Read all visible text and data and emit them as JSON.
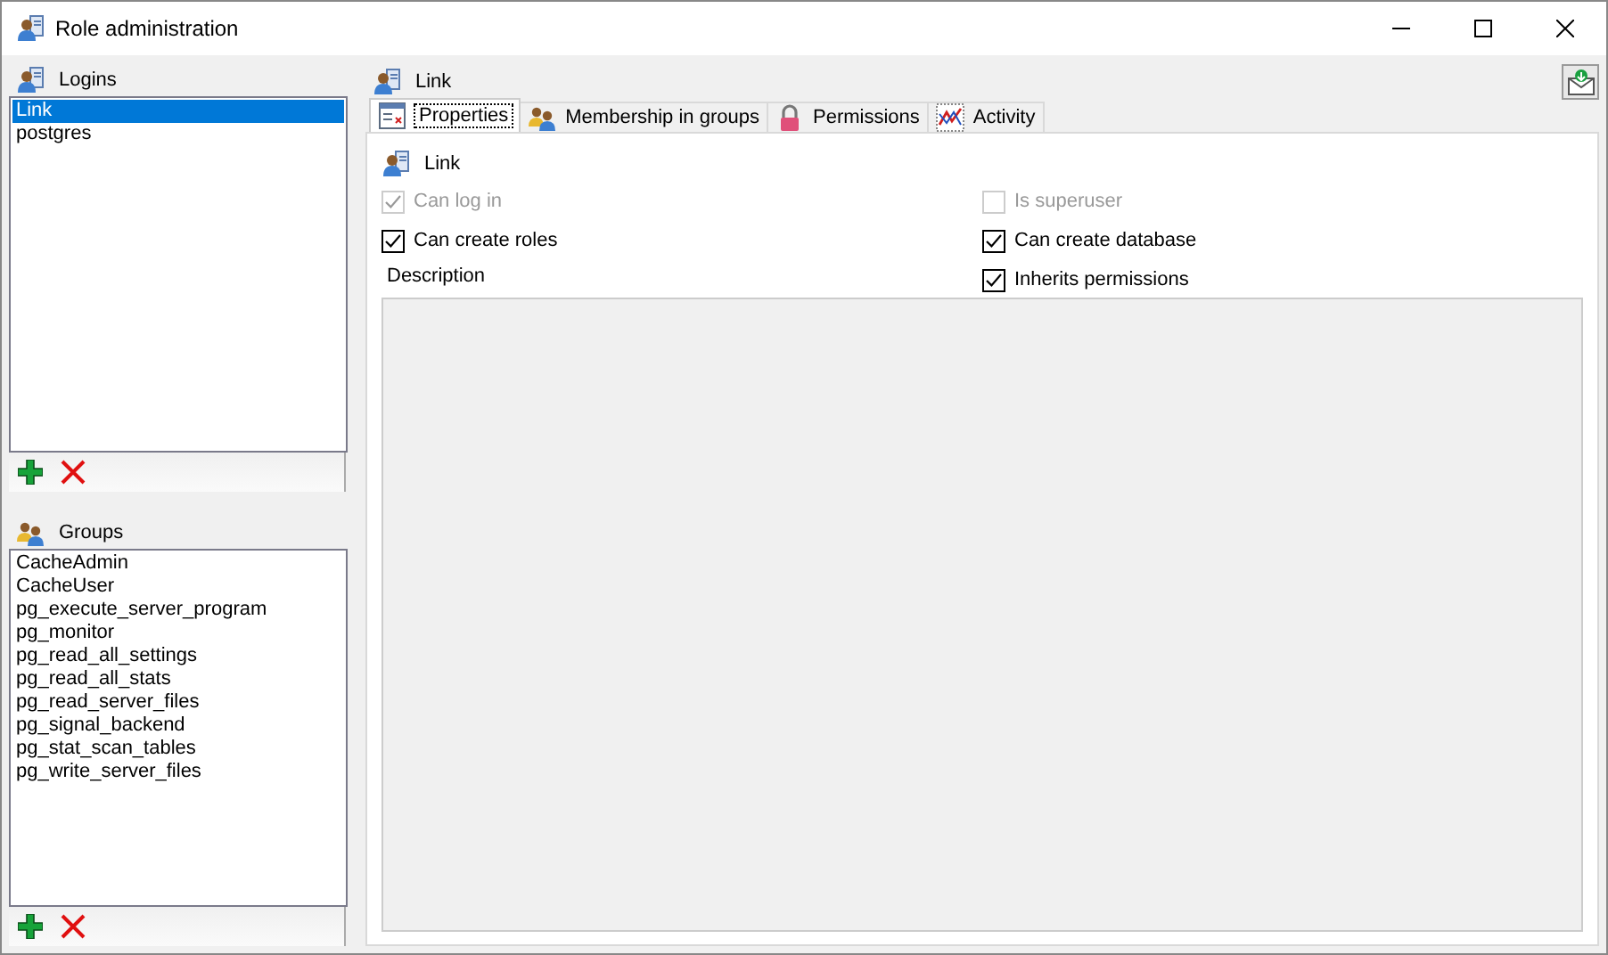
{
  "window": {
    "title": "Role administration"
  },
  "logins": {
    "title": "Logins",
    "items": [
      {
        "label": "Link",
        "selected": true
      },
      {
        "label": "postgres",
        "selected": false
      }
    ]
  },
  "groups": {
    "title": "Groups",
    "items": [
      {
        "label": "CacheAdmin",
        "selected": false
      },
      {
        "label": "CacheUser",
        "selected": false
      },
      {
        "label": "pg_execute_server_program",
        "selected": false
      },
      {
        "label": "pg_monitor",
        "selected": false
      },
      {
        "label": "pg_read_all_settings",
        "selected": false
      },
      {
        "label": "pg_read_all_stats",
        "selected": false
      },
      {
        "label": "pg_read_server_files",
        "selected": false
      },
      {
        "label": "pg_signal_backend",
        "selected": false
      },
      {
        "label": "pg_stat_scan_tables",
        "selected": false
      },
      {
        "label": "pg_write_server_files",
        "selected": false
      }
    ]
  },
  "detail": {
    "title": "Link",
    "tabs": [
      {
        "label": "Properties",
        "kind": "properties",
        "selected": true
      },
      {
        "label": "Membership in groups",
        "kind": "groups",
        "selected": false
      },
      {
        "label": "Permissions",
        "kind": "lock",
        "selected": false
      },
      {
        "label": "Activity",
        "kind": "activity",
        "selected": false
      }
    ],
    "role_name": "Link",
    "left_options": [
      {
        "label": "Can log in",
        "checked": true,
        "disabled": true
      },
      {
        "label": "Can create roles",
        "checked": true,
        "disabled": false
      }
    ],
    "right_options": [
      {
        "label": "Is superuser",
        "checked": false,
        "disabled": true
      },
      {
        "label": "Can create database",
        "checked": true,
        "disabled": false
      },
      {
        "label": "Inherits permissions",
        "checked": true,
        "disabled": false
      }
    ],
    "description_label": "Description"
  }
}
